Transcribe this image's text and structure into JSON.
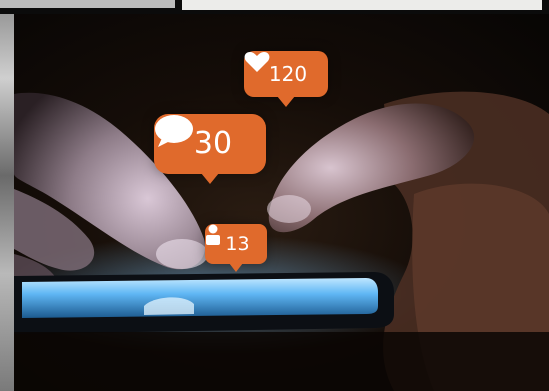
{
  "notifications": {
    "likes": {
      "count": "120",
      "icon": "heart-icon"
    },
    "comments": {
      "count": "30",
      "icon": "speech-bubble-icon"
    },
    "followers": {
      "count": "13",
      "icon": "person-icon"
    }
  },
  "colors": {
    "bubble": "#e06a2c",
    "screen": "#6fc3ff"
  }
}
